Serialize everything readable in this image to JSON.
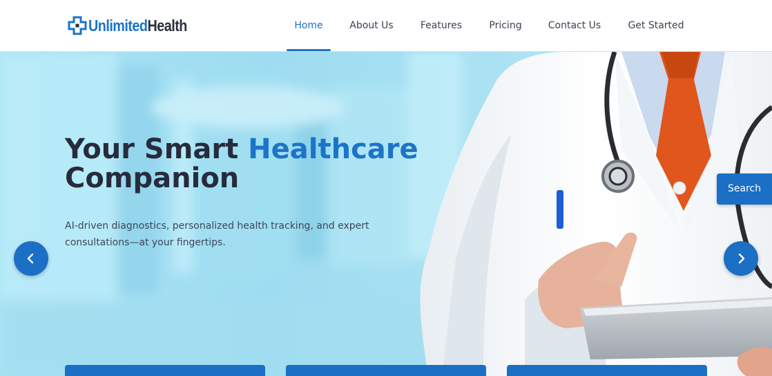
{
  "brand": {
    "name_part1": "Unlimited",
    "name_part2": "Health",
    "primary_color": "#1b74c8",
    "dark_color": "#2a2f3a",
    "icon": "cross-logo-icon"
  },
  "nav": {
    "items": [
      {
        "label": "Home",
        "active": true
      },
      {
        "label": "About Us",
        "active": false
      },
      {
        "label": "Features",
        "active": false
      },
      {
        "label": "Pricing",
        "active": false
      },
      {
        "label": "Contact Us",
        "active": false
      },
      {
        "label": "Get Started",
        "active": false
      }
    ]
  },
  "hero": {
    "title_part1": "Your Smart ",
    "title_accent": "Healthcare",
    "title_part2": "Companion",
    "subtitle": "AI-driven diagnostics, personalized health tracking, and expert consultations—at your fingertips.",
    "prev_icon": "chevron-left-icon",
    "next_icon": "chevron-right-icon",
    "search_label": "Search",
    "image": "doctor-with-tablet-and-stethoscope"
  }
}
